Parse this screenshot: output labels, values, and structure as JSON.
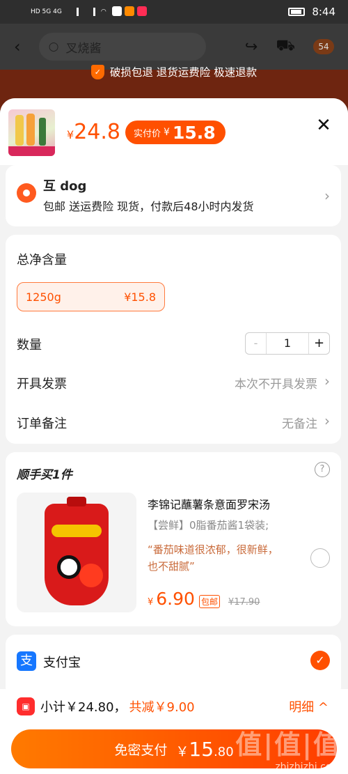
{
  "status_bar": {
    "network_left": "HD 5G 4G",
    "time": "8:44"
  },
  "background_header": {
    "search_text": "叉烧酱",
    "cart_badge": "54"
  },
  "guarantee": {
    "text": "破损包退 退货运费险 极速退款"
  },
  "sheet": {
    "price": {
      "currency": "¥",
      "value": "24.8"
    },
    "pay_pill": {
      "label": "实付价",
      "currency": "¥",
      "value": "15.8"
    }
  },
  "address": {
    "name": "互 dog",
    "description": "包邮  送运费险  现货，付款后48小时内发货"
  },
  "options": {
    "net_content_label": "总净含量",
    "sku": {
      "name": "1250g",
      "price": "¥15.8"
    },
    "quantity_label": "数量",
    "quantity": "1",
    "minus": "-",
    "plus": "+",
    "invoice_label": "开具发票",
    "invoice_value": "本次不开具发票",
    "remark_label": "订单备注",
    "remark_value": "无备注"
  },
  "addon": {
    "title": "顺手买1件",
    "help": "?",
    "product_title": "李锦记蘸薯条意面罗宋汤",
    "product_sub": "【尝鲜】0脂番茄酱1袋装;",
    "product_quote": "“番茄味道很浓郁，很新鲜，也不甜腻”",
    "price_currency": "¥",
    "price": "6.90",
    "free_shipping": "包邮",
    "old_price": "¥17.90"
  },
  "payment": {
    "method": "支付宝",
    "icon": "支"
  },
  "bottom": {
    "subtotal": "小计￥24.80，",
    "discount": "共减￥9.00",
    "detail": "明细 ^",
    "pay_label": "免密支付",
    "pay_currency": "￥",
    "pay_amount": "15",
    "pay_decimal": ".80"
  },
  "watermark": {
    "logo": "值|值|值",
    "url": "zhizhizhi.com"
  },
  "colors": {
    "accent": "#ff5000",
    "alipay": "#1677ff"
  }
}
